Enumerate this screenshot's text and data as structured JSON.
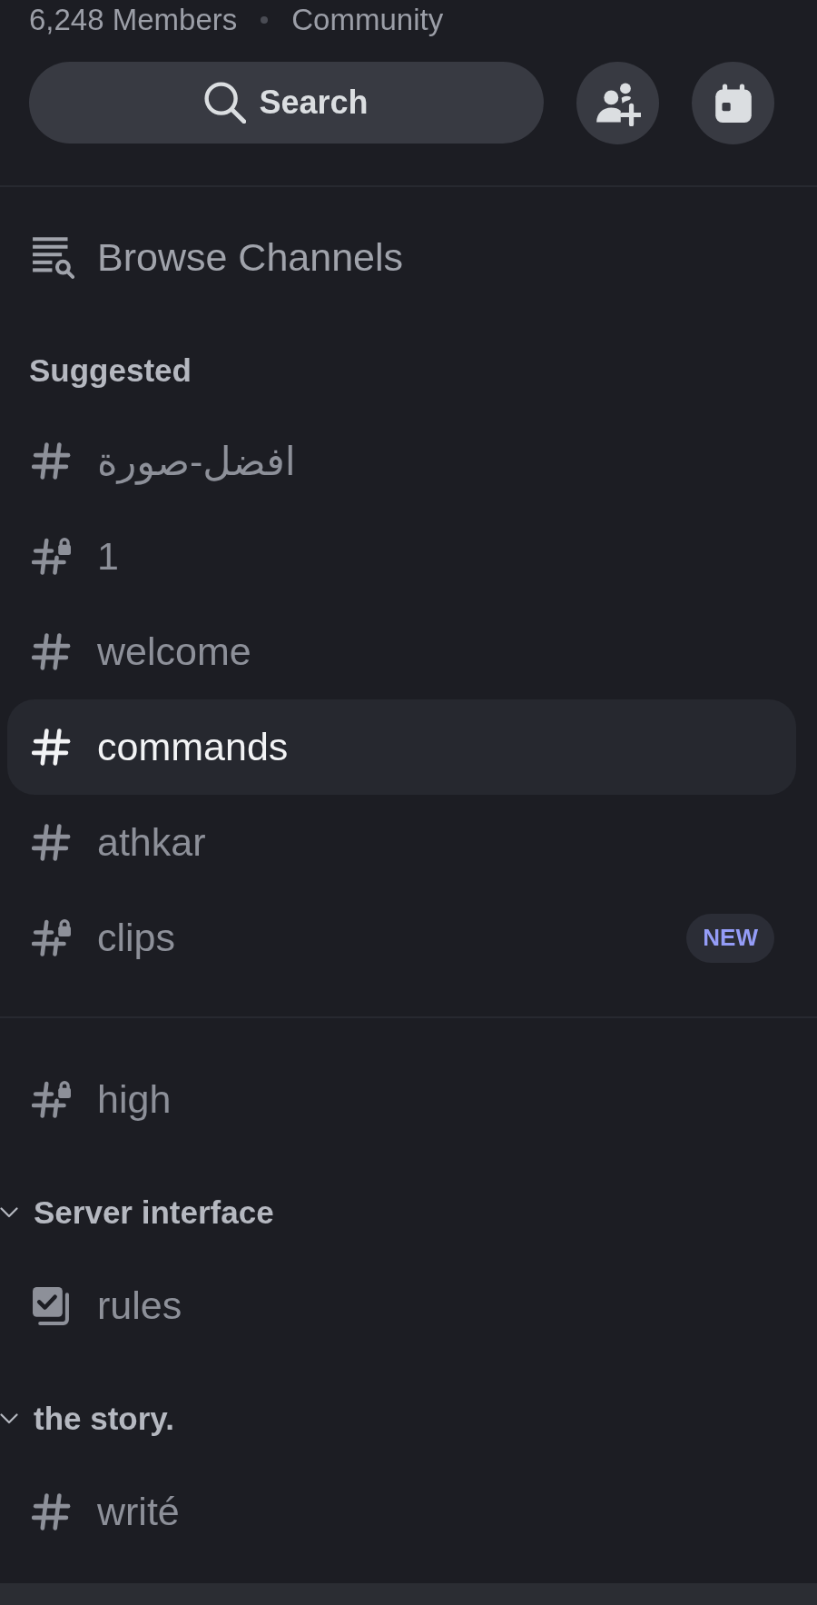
{
  "header": {
    "members": "6,248 Members",
    "type": "Community"
  },
  "search": {
    "label": "Search"
  },
  "browse": {
    "label": "Browse Channels"
  },
  "suggested": {
    "title": "Suggested",
    "channels": [
      {
        "name": "افضل-صورة",
        "kind": "text",
        "selected": false
      },
      {
        "name": "1",
        "kind": "locked",
        "selected": false
      },
      {
        "name": "welcome",
        "kind": "text",
        "selected": false
      },
      {
        "name": "commands",
        "kind": "text",
        "selected": true
      },
      {
        "name": "athkar",
        "kind": "text",
        "selected": false
      },
      {
        "name": "clips",
        "kind": "locked",
        "selected": false,
        "badge": "NEW"
      }
    ]
  },
  "channels": [
    {
      "name": "high",
      "kind": "locked",
      "selected": false
    }
  ],
  "categories": [
    {
      "title": "Server interface",
      "expanded": true,
      "channels": [
        {
          "name": "rules",
          "kind": "rules",
          "selected": false
        }
      ]
    },
    {
      "title": "the story.",
      "expanded": true,
      "channels": [
        {
          "name": "writé",
          "kind": "text",
          "selected": false
        }
      ]
    }
  ]
}
